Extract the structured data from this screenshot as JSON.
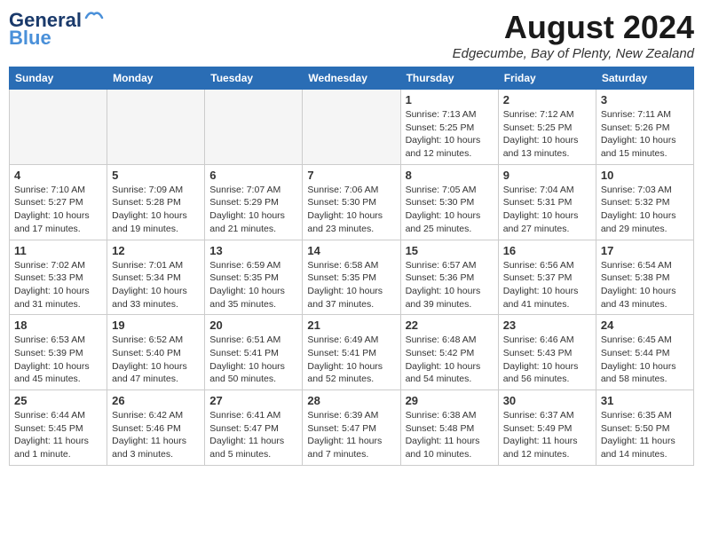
{
  "header": {
    "logo_line1": "General",
    "logo_line2": "Blue",
    "month_title": "August 2024",
    "subtitle": "Edgecumbe, Bay of Plenty, New Zealand"
  },
  "days_of_week": [
    "Sunday",
    "Monday",
    "Tuesday",
    "Wednesday",
    "Thursday",
    "Friday",
    "Saturday"
  ],
  "weeks": [
    [
      {
        "day": "",
        "info": ""
      },
      {
        "day": "",
        "info": ""
      },
      {
        "day": "",
        "info": ""
      },
      {
        "day": "",
        "info": ""
      },
      {
        "day": "1",
        "info": "Sunrise: 7:13 AM\nSunset: 5:25 PM\nDaylight: 10 hours\nand 12 minutes."
      },
      {
        "day": "2",
        "info": "Sunrise: 7:12 AM\nSunset: 5:25 PM\nDaylight: 10 hours\nand 13 minutes."
      },
      {
        "day": "3",
        "info": "Sunrise: 7:11 AM\nSunset: 5:26 PM\nDaylight: 10 hours\nand 15 minutes."
      }
    ],
    [
      {
        "day": "4",
        "info": "Sunrise: 7:10 AM\nSunset: 5:27 PM\nDaylight: 10 hours\nand 17 minutes."
      },
      {
        "day": "5",
        "info": "Sunrise: 7:09 AM\nSunset: 5:28 PM\nDaylight: 10 hours\nand 19 minutes."
      },
      {
        "day": "6",
        "info": "Sunrise: 7:07 AM\nSunset: 5:29 PM\nDaylight: 10 hours\nand 21 minutes."
      },
      {
        "day": "7",
        "info": "Sunrise: 7:06 AM\nSunset: 5:30 PM\nDaylight: 10 hours\nand 23 minutes."
      },
      {
        "day": "8",
        "info": "Sunrise: 7:05 AM\nSunset: 5:30 PM\nDaylight: 10 hours\nand 25 minutes."
      },
      {
        "day": "9",
        "info": "Sunrise: 7:04 AM\nSunset: 5:31 PM\nDaylight: 10 hours\nand 27 minutes."
      },
      {
        "day": "10",
        "info": "Sunrise: 7:03 AM\nSunset: 5:32 PM\nDaylight: 10 hours\nand 29 minutes."
      }
    ],
    [
      {
        "day": "11",
        "info": "Sunrise: 7:02 AM\nSunset: 5:33 PM\nDaylight: 10 hours\nand 31 minutes."
      },
      {
        "day": "12",
        "info": "Sunrise: 7:01 AM\nSunset: 5:34 PM\nDaylight: 10 hours\nand 33 minutes."
      },
      {
        "day": "13",
        "info": "Sunrise: 6:59 AM\nSunset: 5:35 PM\nDaylight: 10 hours\nand 35 minutes."
      },
      {
        "day": "14",
        "info": "Sunrise: 6:58 AM\nSunset: 5:35 PM\nDaylight: 10 hours\nand 37 minutes."
      },
      {
        "day": "15",
        "info": "Sunrise: 6:57 AM\nSunset: 5:36 PM\nDaylight: 10 hours\nand 39 minutes."
      },
      {
        "day": "16",
        "info": "Sunrise: 6:56 AM\nSunset: 5:37 PM\nDaylight: 10 hours\nand 41 minutes."
      },
      {
        "day": "17",
        "info": "Sunrise: 6:54 AM\nSunset: 5:38 PM\nDaylight: 10 hours\nand 43 minutes."
      }
    ],
    [
      {
        "day": "18",
        "info": "Sunrise: 6:53 AM\nSunset: 5:39 PM\nDaylight: 10 hours\nand 45 minutes."
      },
      {
        "day": "19",
        "info": "Sunrise: 6:52 AM\nSunset: 5:40 PM\nDaylight: 10 hours\nand 47 minutes."
      },
      {
        "day": "20",
        "info": "Sunrise: 6:51 AM\nSunset: 5:41 PM\nDaylight: 10 hours\nand 50 minutes."
      },
      {
        "day": "21",
        "info": "Sunrise: 6:49 AM\nSunset: 5:41 PM\nDaylight: 10 hours\nand 52 minutes."
      },
      {
        "day": "22",
        "info": "Sunrise: 6:48 AM\nSunset: 5:42 PM\nDaylight: 10 hours\nand 54 minutes."
      },
      {
        "day": "23",
        "info": "Sunrise: 6:46 AM\nSunset: 5:43 PM\nDaylight: 10 hours\nand 56 minutes."
      },
      {
        "day": "24",
        "info": "Sunrise: 6:45 AM\nSunset: 5:44 PM\nDaylight: 10 hours\nand 58 minutes."
      }
    ],
    [
      {
        "day": "25",
        "info": "Sunrise: 6:44 AM\nSunset: 5:45 PM\nDaylight: 11 hours\nand 1 minute."
      },
      {
        "day": "26",
        "info": "Sunrise: 6:42 AM\nSunset: 5:46 PM\nDaylight: 11 hours\nand 3 minutes."
      },
      {
        "day": "27",
        "info": "Sunrise: 6:41 AM\nSunset: 5:47 PM\nDaylight: 11 hours\nand 5 minutes."
      },
      {
        "day": "28",
        "info": "Sunrise: 6:39 AM\nSunset: 5:47 PM\nDaylight: 11 hours\nand 7 minutes."
      },
      {
        "day": "29",
        "info": "Sunrise: 6:38 AM\nSunset: 5:48 PM\nDaylight: 11 hours\nand 10 minutes."
      },
      {
        "day": "30",
        "info": "Sunrise: 6:37 AM\nSunset: 5:49 PM\nDaylight: 11 hours\nand 12 minutes."
      },
      {
        "day": "31",
        "info": "Sunrise: 6:35 AM\nSunset: 5:50 PM\nDaylight: 11 hours\nand 14 minutes."
      }
    ]
  ]
}
